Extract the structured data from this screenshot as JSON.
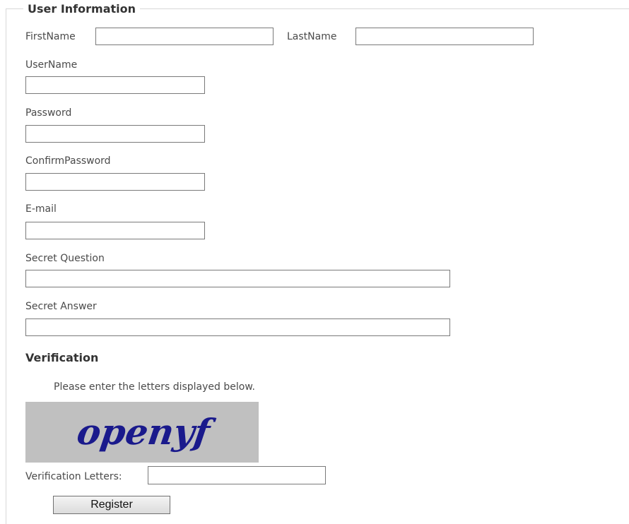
{
  "user_information": {
    "legend": "User Information",
    "first_name_label": "FirstName",
    "first_name_value": "",
    "last_name_label": "LastName",
    "last_name_value": "",
    "username_label": "UserName",
    "username_value": "",
    "password_label": "Password",
    "password_value": "",
    "confirm_password_label": "ConfirmPassword",
    "confirm_password_value": "",
    "email_label": "E-mail",
    "email_value": "",
    "secret_question_label": "Secret Question",
    "secret_question_value": "",
    "secret_answer_label": "Secret Answer",
    "secret_answer_value": ""
  },
  "verification": {
    "title": "Verification",
    "instructions": "Please enter the letters displayed below.",
    "captcha_text": "openyf",
    "captcha_background": "#c0c0c0",
    "captcha_text_color": "#1a1a8c",
    "letters_label": "Verification Letters:",
    "letters_value": "",
    "register_label": "Register"
  }
}
